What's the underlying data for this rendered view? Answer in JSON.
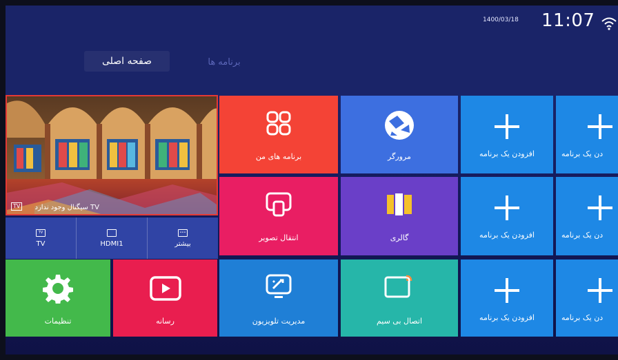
{
  "status": {
    "date": "1400/03/18",
    "time": "11:07"
  },
  "tabs": [
    {
      "label": "صفحه اصلی",
      "active": true
    },
    {
      "label": "برنامه ها",
      "active": false
    }
  ],
  "preview": {
    "no_signal": "سیگنال وجود ندارد TV",
    "badge": "TV"
  },
  "sources": [
    {
      "label": "TV",
      "icon": "tv-icon"
    },
    {
      "label": "HDMI1",
      "icon": "hdmi-icon"
    },
    {
      "label": "بیشتر",
      "icon": "more-icon"
    }
  ],
  "tiles": {
    "my_apps": {
      "label": "برنامه های من",
      "color": "#f44336",
      "icon": "apps-grid-icon"
    },
    "browser": {
      "label": "مرورگر",
      "color": "#3d6fe0",
      "icon": "browser-icon"
    },
    "screen_cast": {
      "label": "انتقال تصویر",
      "color": "#e91e63",
      "icon": "screen-cast-icon"
    },
    "gallery": {
      "label": "گالری",
      "color": "#6a3fc8",
      "icon": "gallery-icon"
    },
    "settings": {
      "label": "تنظیمات",
      "color": "#43b94b",
      "icon": "gear-icon"
    },
    "media": {
      "label": "رسانه",
      "color": "#e91e4f",
      "icon": "play-icon"
    },
    "tv_manager": {
      "label": "مدیریت تلویزیون",
      "color": "#1f7fd6",
      "icon": "tv-manager-icon"
    },
    "wireless": {
      "label": "اتصال بی سیم",
      "color": "#26b6a9",
      "icon": "wireless-display-icon"
    },
    "add_app_label": "افزودن یک برنامه",
    "add_app_label_cropped": "دن یک برنامه",
    "add_color": "#1e88e5"
  }
}
